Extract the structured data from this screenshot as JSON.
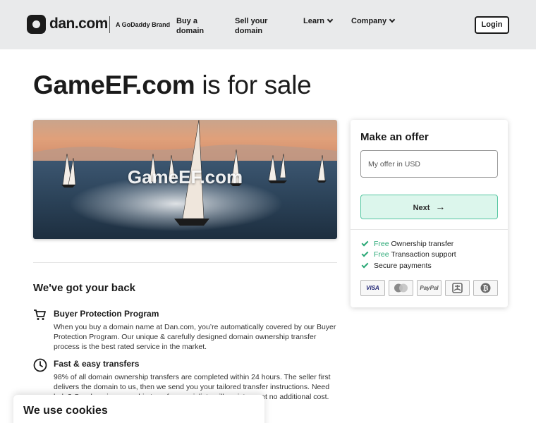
{
  "header": {
    "logo_text": "dan.com",
    "brand_text": "A GoDaddy Brand",
    "nav": [
      {
        "label": "Buy a domain"
      },
      {
        "label": "Sell your domain"
      },
      {
        "label": "Learn"
      },
      {
        "label": "Company"
      }
    ],
    "login_label": "Login"
  },
  "title": {
    "domain": "GameEF.com",
    "suffix": " is for sale"
  },
  "hero": {
    "label": "GameEF.com"
  },
  "back": {
    "heading": "We've got your back",
    "features": [
      {
        "icon": "cart-icon",
        "title": "Buyer Protection Program",
        "text": "When you buy a domain name at Dan.com, you’re automatically covered by our Buyer Protection Program. Our unique & carefully designed domain ownership transfer process is the best rated service in the market."
      },
      {
        "icon": "clock-icon",
        "title": "Fast & easy transfers",
        "text": "98% of all domain ownership transfers are completed within 24 hours. The seller first delivers the domain to us, then we send you your tailored transfer instructions. Need help? Our domain ownership transfer specialists will assist you at no additional cost."
      }
    ]
  },
  "offer": {
    "title": "Make an offer",
    "input_placeholder": "My offer in USD",
    "next_label": "Next",
    "perks": [
      {
        "free": "Free",
        "text": " Ownership transfer"
      },
      {
        "free": "Free",
        "text": " Transaction support"
      },
      {
        "free": "",
        "text": "Secure payments"
      }
    ],
    "payment_methods": [
      "VISA",
      "mastercard",
      "PayPal",
      "alipay",
      "bitcoin"
    ]
  },
  "cookie": {
    "title": "We use cookies"
  },
  "colors": {
    "header_bg": "#e9eaeb",
    "accent_green": "#2aa876",
    "next_bg": "#dcf6ec"
  }
}
